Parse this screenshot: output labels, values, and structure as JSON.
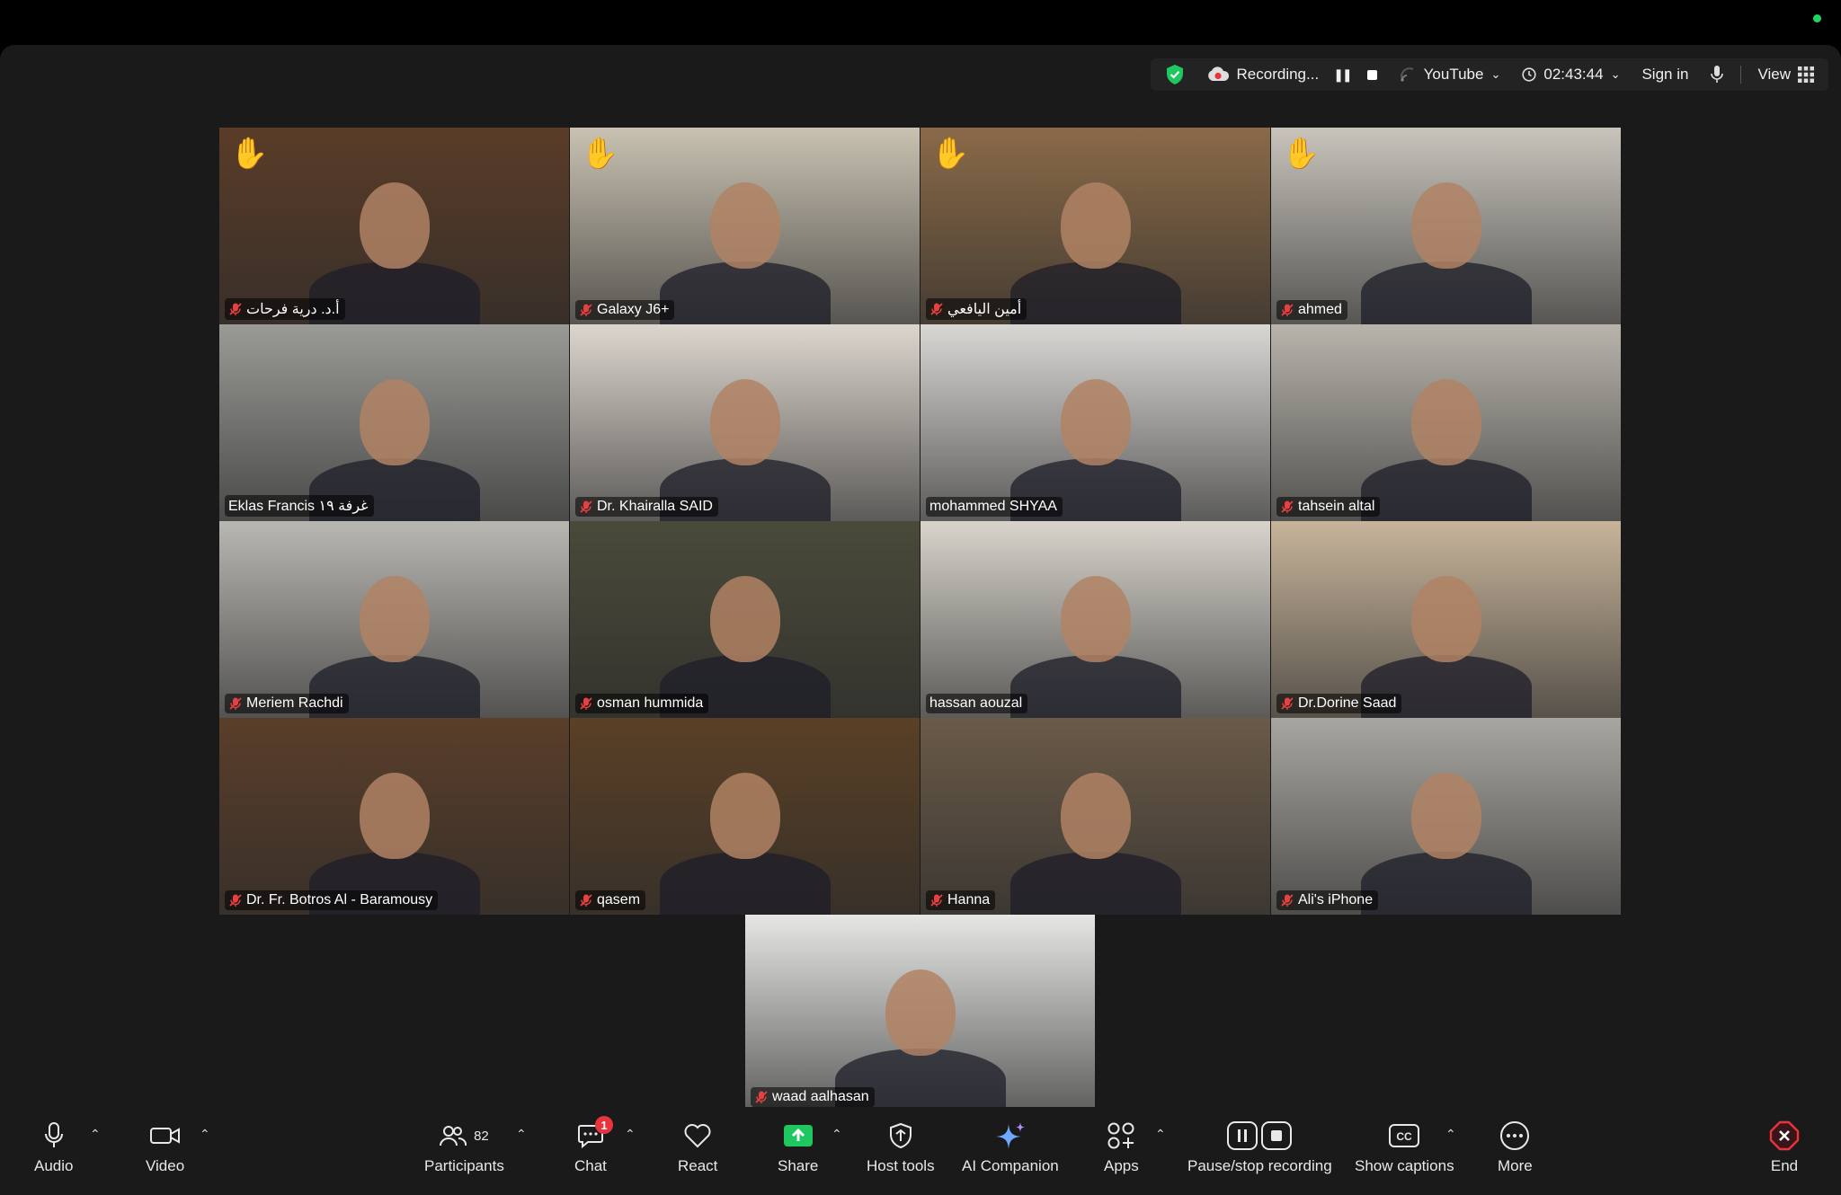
{
  "topbar": {
    "recording_label": "Recording...",
    "youtube_label": "YouTube",
    "timer": "02:43:44",
    "sign_in_label": "Sign in",
    "view_label": "View"
  },
  "participants": [
    {
      "name": "أ.د. درية فرحات",
      "hand_raised": true,
      "muted": true,
      "bg": "#5a3c28"
    },
    {
      "name": "Galaxy J6+",
      "hand_raised": true,
      "muted": true,
      "bg": "#c9c2b2"
    },
    {
      "name": "أمين اليافعي",
      "hand_raised": true,
      "muted": true,
      "bg": "#8a6a48"
    },
    {
      "name": "ahmed",
      "hand_raised": true,
      "muted": true,
      "bg": "#c8c4bc"
    },
    {
      "name": "Eklas Francis غرفة ١٩",
      "hand_raised": false,
      "muted": false,
      "bg": "#9a9a96"
    },
    {
      "name": "Dr. Khairalla SAID",
      "hand_raised": false,
      "muted": true,
      "bg": "#dcd6ce"
    },
    {
      "name": "mohammed SHYAA",
      "hand_raised": false,
      "muted": false,
      "speaking": true,
      "bg": "#d9d7d4"
    },
    {
      "name": "tahsein altal",
      "hand_raised": false,
      "muted": true,
      "bg": "#b8b4ac"
    },
    {
      "name": "Meriem Rachdi",
      "hand_raised": false,
      "muted": true,
      "bg": "#b9b7b2"
    },
    {
      "name": "osman hummida",
      "hand_raised": false,
      "muted": true,
      "bg": "#4a4a3a"
    },
    {
      "name": "hassan aouzal",
      "hand_raised": false,
      "muted": false,
      "bg": "#d8d4cc"
    },
    {
      "name": "Dr.Dorine Saad",
      "hand_raised": false,
      "muted": true,
      "bg": "#c7b49a"
    },
    {
      "name": "Dr. Fr. Botros Al - Baramousy",
      "hand_raised": false,
      "muted": true,
      "bg": "#5a3e2a"
    },
    {
      "name": "qasem",
      "hand_raised": false,
      "muted": true,
      "bg": "#5a4026"
    },
    {
      "name": "Hanna",
      "hand_raised": false,
      "muted": true,
      "bg": "#6a5a48"
    },
    {
      "name": "Ali's iPhone",
      "hand_raised": false,
      "muted": true,
      "bg": "#a8a6a0"
    },
    {
      "name": "waad aalhasan",
      "hand_raised": false,
      "muted": true,
      "bg": "#e6e6e4"
    }
  ],
  "toolbar": {
    "audio": "Audio",
    "video": "Video",
    "participants": "Participants",
    "participants_count": "82",
    "chat": "Chat",
    "chat_badge": "1",
    "react": "React",
    "share": "Share",
    "host_tools": "Host tools",
    "ai_companion": "AI Companion",
    "apps": "Apps",
    "pause_recording": "Pause/stop recording",
    "show_captions": "Show captions",
    "more": "More",
    "end": "End"
  },
  "colors": {
    "speaking_border": "#23d160",
    "end_red": "#e8343e",
    "share_green": "#1ec760",
    "shield_green": "#1ec760"
  }
}
